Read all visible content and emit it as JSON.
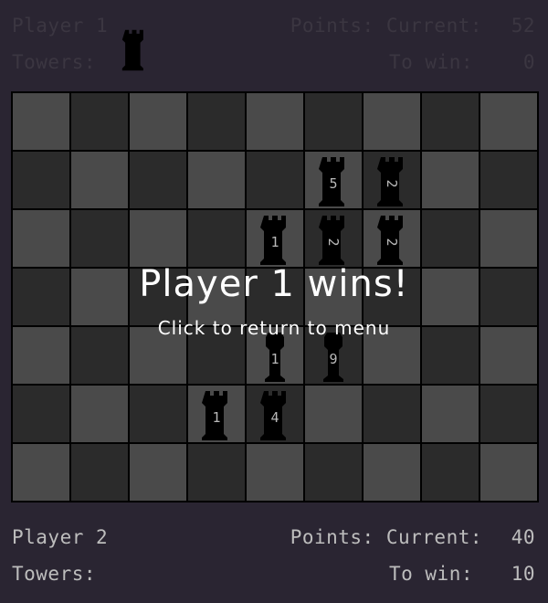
{
  "players": {
    "top": {
      "name": "Player 1",
      "towers_label": "Towers:",
      "points_label": "Points: Current:",
      "points_current": "52",
      "to_win_label": "To win:",
      "to_win": "0",
      "tower_count": 1
    },
    "bottom": {
      "name": "Player 2",
      "towers_label": "Towers:",
      "points_label": "Points: Current:",
      "points_current": "40",
      "to_win_label": "To win:",
      "to_win": "10",
      "tower_count": 0
    }
  },
  "board": {
    "cols": 9,
    "rows": 7,
    "colors": {
      "light": "#4a4a4a",
      "dark": "#2b2b2b",
      "piece": "#000000"
    },
    "pieces": [
      {
        "type": "tower",
        "col": 5,
        "row": 1,
        "label": "5",
        "rotated": false
      },
      {
        "type": "tower",
        "col": 6,
        "row": 1,
        "label": "2",
        "rotated": true
      },
      {
        "type": "tower",
        "col": 4,
        "row": 2,
        "label": "1",
        "rotated": false
      },
      {
        "type": "tower",
        "col": 5,
        "row": 2,
        "label": "2",
        "rotated": true
      },
      {
        "type": "tower",
        "col": 6,
        "row": 2,
        "label": "2",
        "rotated": true
      },
      {
        "type": "pawn",
        "col": 4,
        "row": 4,
        "label": "1",
        "rotated": false
      },
      {
        "type": "pawn",
        "col": 5,
        "row": 4,
        "label": "9",
        "rotated": false
      },
      {
        "type": "tower",
        "col": 3,
        "row": 5,
        "label": "1",
        "rotated": false
      },
      {
        "type": "tower",
        "col": 4,
        "row": 5,
        "label": "4",
        "rotated": false
      }
    ]
  },
  "banner": {
    "title": "Player 1 wins!",
    "subtitle": "Click to return to menu"
  }
}
